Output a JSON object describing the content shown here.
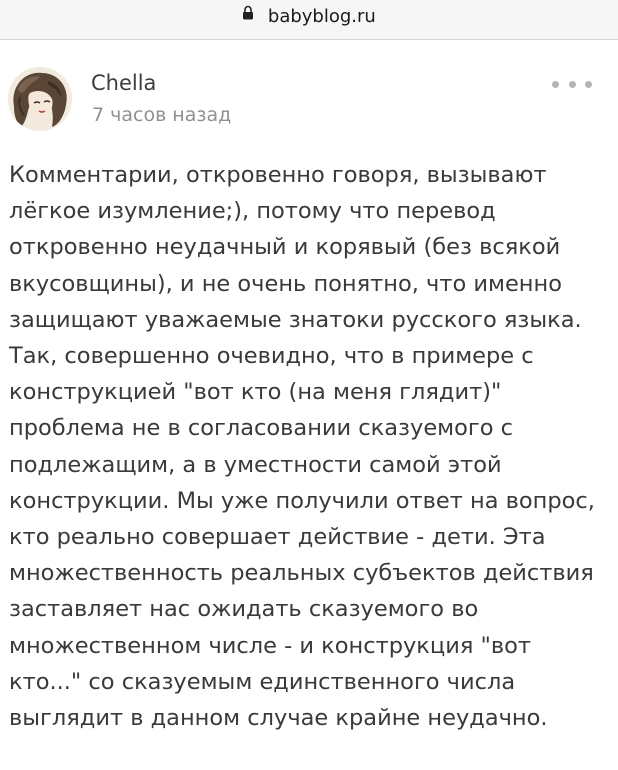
{
  "browser": {
    "url": "babyblog.ru",
    "lock_icon": "lock-icon"
  },
  "post": {
    "author": "Chella",
    "time": "7 часов назад",
    "more_icon": "more-horizontal-icon",
    "comment": "Комментарии, откровенно говоря, вызывают лёгкое изумление;), потому что перевод откровенно неудачный и корявый (без всякой вкусовщины), и не очень понятно, что именно защищают уважаемые знатоки русского языка. Так, совершенно очевидно, что в примере с конструкцией \"вот кто (на меня глядит)\" проблема не в согласовании сказуемого с подлежащим, а в уместности самой этой конструкции. Мы уже получили ответ на вопрос, кто реально совершает действие - дети. Эта множественность реальных субъектов действия заставляет нас ожидать сказуемого во множественном числе - и конструкция \"вот кто...\" со сказуемым единственного числа выглядит в данном случае крайне неудачно."
  },
  "colors": {
    "text": "#3a3a3a",
    "muted": "#909090",
    "urlbar_bg": "#f6f6f6"
  }
}
